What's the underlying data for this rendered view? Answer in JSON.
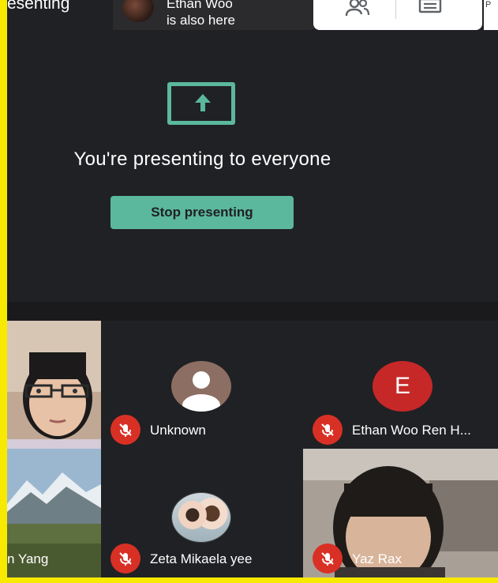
{
  "topbar": {
    "presenting_text": "esenting",
    "notice_line1": "Ethan Woo",
    "notice_line2": "is also here",
    "edge_text": "P"
  },
  "present": {
    "title": "You're presenting to everyone",
    "stop_label": "Stop presenting"
  },
  "participants": [
    {
      "name": "",
      "muted": false
    },
    {
      "name": "Unknown",
      "muted": true
    },
    {
      "name": "Ethan Woo Ren H...",
      "avatar_letter": "E",
      "muted": true
    },
    {
      "name": "n Yang",
      "muted": false
    },
    {
      "name": "Zeta Mikaela yee",
      "muted": true
    },
    {
      "name": "Yaz Rax",
      "muted": true
    }
  ],
  "colors": {
    "accent": "#5bb89c",
    "background": "#202124",
    "mute_red": "#d93025",
    "avatar_e": "#c62828",
    "avatar_unknown": "#8d6e63",
    "outer_border": "#f7e900"
  },
  "icons": {
    "present": "present-to-all-icon",
    "people": "people-icon",
    "chat": "chat-icon",
    "mic_off": "mic-off-icon"
  }
}
